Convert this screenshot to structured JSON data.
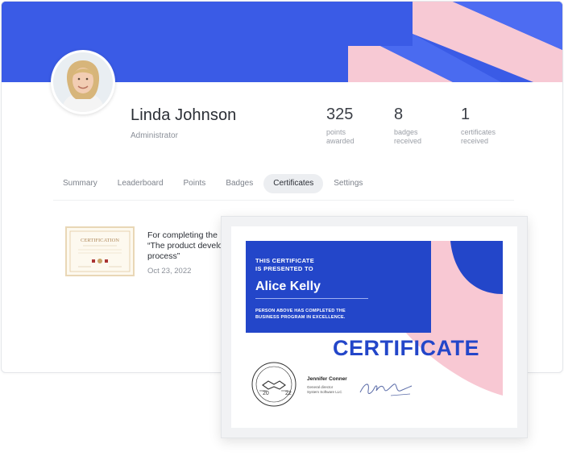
{
  "profile": {
    "name": "Linda Johnson",
    "role": "Administrator"
  },
  "stats": [
    {
      "value": "325",
      "label": "points\nawarded"
    },
    {
      "value": "8",
      "label": "badges\nreceived"
    },
    {
      "value": "1",
      "label": "certificates\nreceived"
    }
  ],
  "tabs": [
    {
      "label": "Summary",
      "active": false
    },
    {
      "label": "Leaderboard",
      "active": false
    },
    {
      "label": "Points",
      "active": false
    },
    {
      "label": "Badges",
      "active": false
    },
    {
      "label": "Certificates",
      "active": true
    },
    {
      "label": "Settings",
      "active": false
    }
  ],
  "certificate_item": {
    "text": "For completing the\n“The product develo\nprocess”",
    "date": "Oct 23, 2022",
    "thumb_title": "CERTIFICATION"
  },
  "certificate": {
    "presented_line": "THIS CERTIFICATE\nIS PRESENTED TO",
    "recipient": "Alice Kelly",
    "description": "PERSON ABOVE HAS COMPLETED THE\nBUSINESS PROGRAM IN EXCELLENCE.",
    "title": "CERTIFICATE",
    "seal_year_left": "20",
    "seal_year_right": "22",
    "signer_name": "Jennifer Conner",
    "signer_title": "General director\nSystem Software LLC"
  },
  "colors": {
    "banner_blue": "#3a5be6",
    "banner_pink": "#f7c9d4",
    "cert_blue": "#2346c9",
    "cert_pink": "#f8c8d3"
  }
}
